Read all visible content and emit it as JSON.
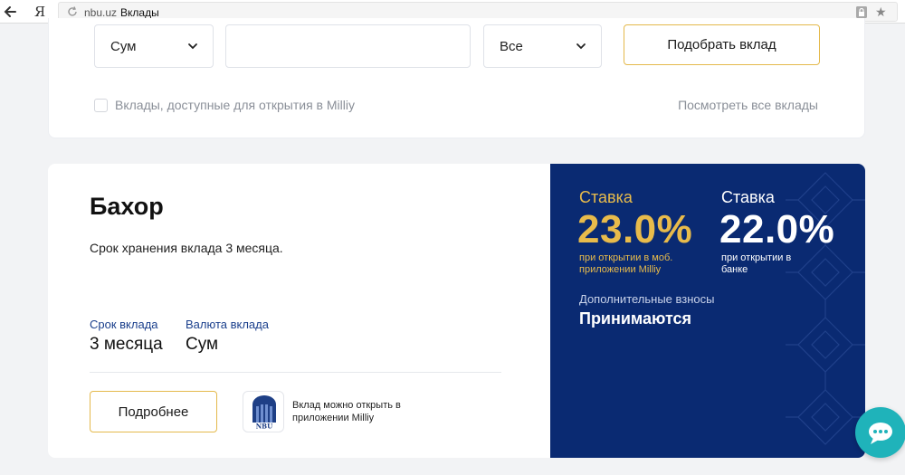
{
  "browser": {
    "logo": "Я",
    "domain": "nbu.uz",
    "page_title": "Вклады"
  },
  "filters": {
    "currency_value": "Сум",
    "search_value": "",
    "search_placeholder": "",
    "type_value": "Все",
    "pick_button": "Подобрать вклад",
    "milliy_checkbox_label": "Вклады, доступные для открытия в Milliy",
    "milliy_checked": false,
    "see_all_link": "Посмотреть все вклады"
  },
  "deposit": {
    "title": "Бахор",
    "description": "Срок хранения вклада 3 месяца.",
    "term_label": "Срок вклада",
    "term_value": "3 месяца",
    "currency_label": "Валюта вклада",
    "currency_value": "Сум",
    "more_button": "Подробнее",
    "logo_text": "NBU",
    "milliy_note": "Вклад можно открыть в приложении Milliy",
    "rate_app": {
      "label": "Ставка",
      "value": "23.0%",
      "note": "при открытии в моб. приложении Milliy"
    },
    "rate_bank": {
      "label": "Ставка",
      "value": "22.0%",
      "note": "при открытии в банке"
    },
    "extra_label": "Дополнительные взносы",
    "extra_value": "Принимаются"
  },
  "colors": {
    "panel_blue": "#0a2a72",
    "gold": "#e8bb4b",
    "accent_border": "#e4b94c",
    "chat_teal": "#1fb3ba"
  },
  "icons": [
    "back-arrow-icon",
    "reload-icon",
    "lock-icon",
    "star-icon",
    "chevron-down-icon",
    "nbu-logo-icon",
    "chat-icon"
  ]
}
